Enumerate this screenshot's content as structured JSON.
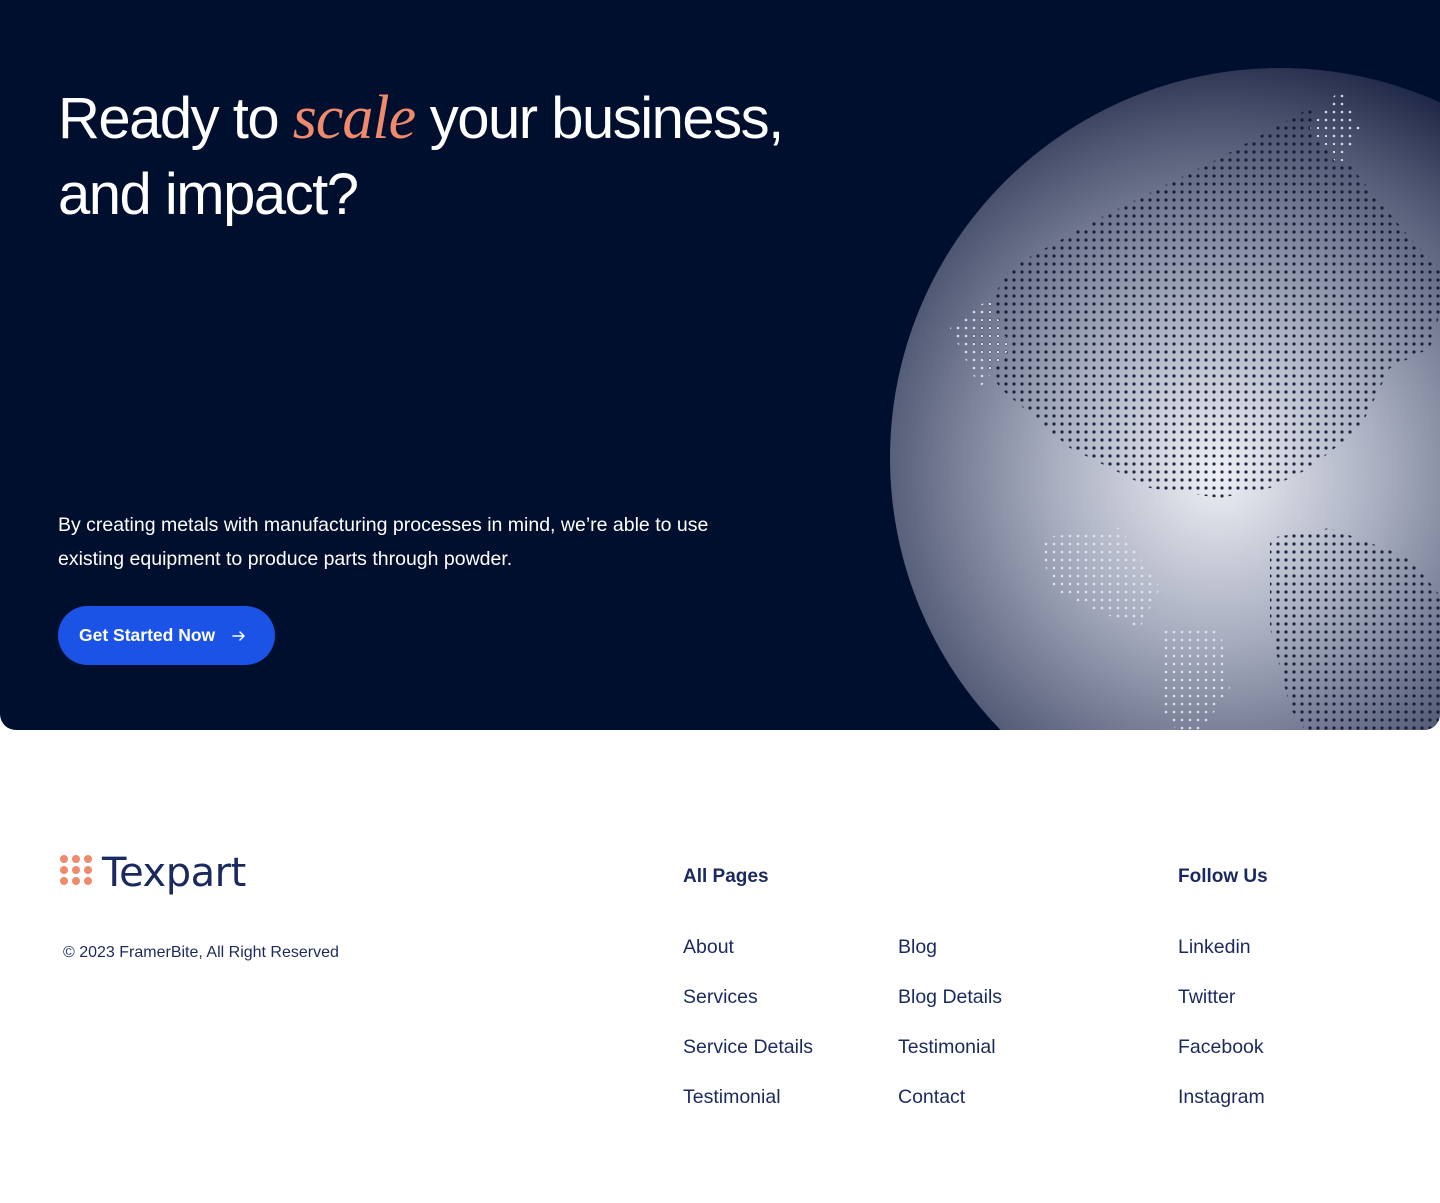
{
  "cta": {
    "headline_before": "Ready to ",
    "headline_accent": "scale",
    "headline_after_1": " your business,",
    "headline_after_2": "and impact?",
    "description": "By creating metals with manufacturing processes in mind, we’re able to use existing equipment to produce parts through powder.",
    "button_label": "Get Started Now",
    "button_icon": "arrow-right-icon",
    "background_color": "#000f2e",
    "accent_color": "#f08a6c",
    "button_color": "#1a53e6"
  },
  "footer": {
    "logo_text": "Texpart",
    "logo_icon": "dot-grid-logo-icon",
    "copyright": "© 2023 FramerBite, All Right Reserved",
    "all_pages": {
      "heading": "All Pages",
      "column_1": [
        "About",
        "Services",
        "Service Details",
        "Testimonial"
      ],
      "column_2": [
        "Blog",
        "Blog Details",
        "Testimonial",
        "Contact"
      ]
    },
    "follow_us": {
      "heading": "Follow Us",
      "links": [
        "Linkedin",
        "Twitter",
        "Facebook",
        "Instagram"
      ]
    },
    "text_color": "#1b2a5e"
  }
}
